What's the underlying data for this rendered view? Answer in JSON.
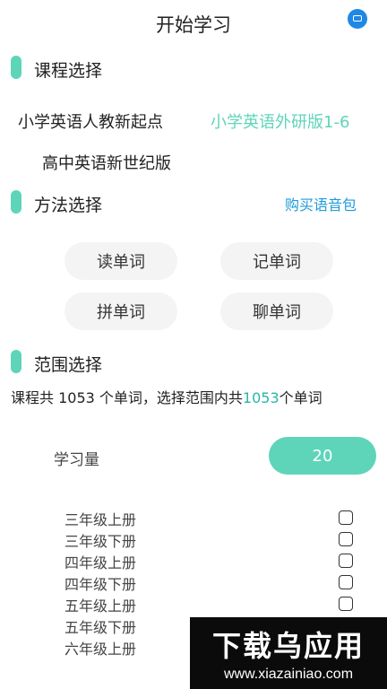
{
  "header": {
    "title": "开始学习",
    "help_icon": "chat-help-icon"
  },
  "courses": {
    "heading": "课程选择",
    "items": [
      {
        "label": "小学英语人教新起点",
        "selected": false
      },
      {
        "label": "小学英语外研版1-6",
        "selected": true
      },
      {
        "label": "高中英语新世纪版",
        "selected": false
      }
    ]
  },
  "methods": {
    "heading": "方法选择",
    "buy_link": "购买语音包",
    "buttons": [
      "读单词",
      "记单词",
      "拼单词",
      "聊单词"
    ]
  },
  "range": {
    "heading": "范围选择",
    "summary_prefix": "课程共 1053 个单词，选择范围内共",
    "summary_count": "1053",
    "summary_suffix": "个单词",
    "amount_label": "学习量",
    "amount_value": "20",
    "grades": [
      {
        "label": "三年级上册",
        "checked": false
      },
      {
        "label": "三年级下册",
        "checked": false
      },
      {
        "label": "四年级上册",
        "checked": false
      },
      {
        "label": "四年级下册",
        "checked": false
      },
      {
        "label": "五年级上册",
        "checked": false
      },
      {
        "label": "五年级下册",
        "checked": false
      },
      {
        "label": "六年级上册",
        "checked": false
      }
    ]
  },
  "watermark": {
    "logo": "下载乌应用",
    "url": "www.xiazainiao.com"
  },
  "colors": {
    "accent": "#5ed5b9",
    "link": "#1e9bd8",
    "help": "#1e88e5"
  }
}
